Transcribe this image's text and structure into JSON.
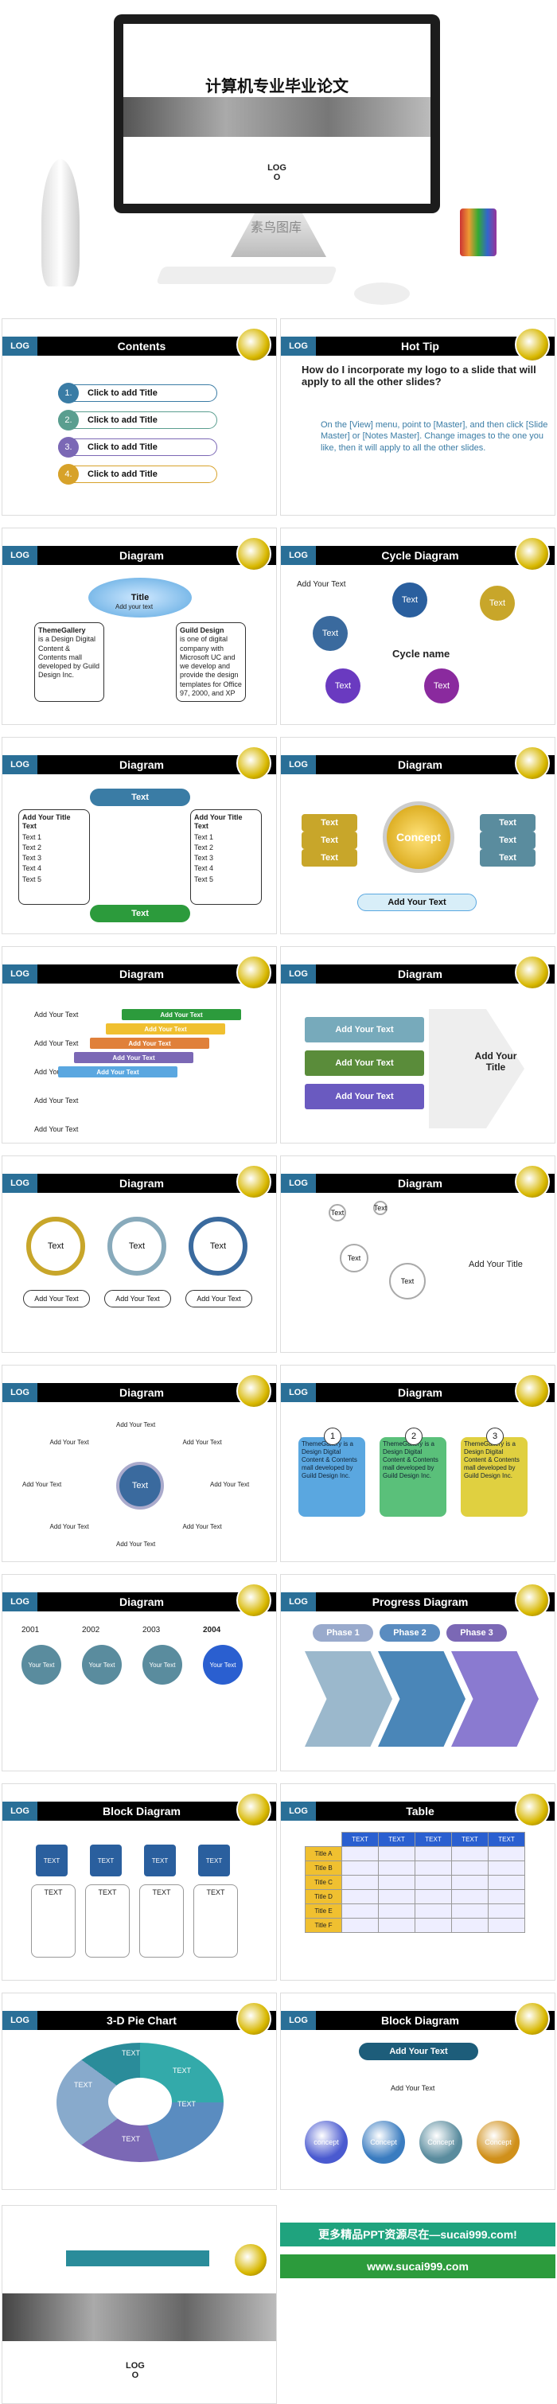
{
  "hero": {
    "title": "计算机专业毕业论文",
    "logo": "LOG\nO",
    "watermark": "素鸟图库"
  },
  "slides": [
    {
      "logo": "LOG",
      "title": "Contents",
      "items": [
        "Click to add Title",
        "Click to add Title",
        "Click to add Title",
        "Click to add Title"
      ],
      "numbers": [
        "1.",
        "2.",
        "3.",
        "4."
      ]
    },
    {
      "logo": "LOG",
      "title": "Hot Tip",
      "heading": "How do I incorporate my logo to a slide that will apply to all the other slides?",
      "body": "On the [View] menu, point to [Master], and then click [Slide Master] or [Notes Master]. Change images to the one you like, then it will apply to all the other slides."
    },
    {
      "logo": "LOG",
      "title": "Diagram",
      "top_title": "Title",
      "top_sub": "Add your text",
      "left_head": "ThemeGallery",
      "left_body": "is a Design Digital Content & Contents mall developed by Guild Design Inc.",
      "right_head": "Guild Design",
      "right_body": "is one of digital company with Microsoft UC and we develop and provide the design templates for Office 97, 2000, and XP"
    },
    {
      "logo": "LOG",
      "title": "Cycle Diagram",
      "add": "Add Your Text",
      "center": "Cycle name",
      "nodes": [
        "Text",
        "Text",
        "Text",
        "Text",
        "Text"
      ]
    },
    {
      "logo": "LOG",
      "title": "Diagram",
      "side_title": "Add Your Title Text",
      "list": [
        "Text 1",
        "Text 2",
        "Text 3",
        "Text 4",
        "Text 5"
      ],
      "bar": "Text"
    },
    {
      "logo": "LOG",
      "title": "Diagram",
      "concept": "Concept",
      "add": "Add Your Text",
      "stack": [
        "Text",
        "Text",
        "Text"
      ]
    },
    {
      "logo": "LOG",
      "title": "Diagram",
      "rows": [
        "Add Your Text",
        "Add Your Text",
        "Add Your Text",
        "Add Your Text",
        "Add Your Text"
      ]
    },
    {
      "logo": "LOG",
      "title": "Diagram",
      "bars": [
        "Add Your Text",
        "Add Your Text",
        "Add Your Text"
      ],
      "arrow": "Add Your Title"
    },
    {
      "logo": "LOG",
      "title": "Diagram",
      "rings": [
        "Text",
        "Text",
        "Text"
      ],
      "labels": [
        "Add Your Text",
        "Add Your Text",
        "Add Your Text"
      ]
    },
    {
      "logo": "LOG",
      "title": "Diagram",
      "bubbles": [
        "Text",
        "Text",
        "Text",
        "Text"
      ],
      "add": "Add Your Title"
    },
    {
      "logo": "LOG",
      "title": "Diagram",
      "center": "Text",
      "spokes": [
        "Add Your Text",
        "Add Your Text",
        "Add Your Text",
        "Add Your Text",
        "Add Your Text",
        "Add Your Text",
        "Add Your Text",
        "Add Your Text"
      ]
    },
    {
      "logo": "LOG",
      "title": "Diagram",
      "cards": [
        "ThemeGallery is a Design Digital Content & Contents mall developed by Guild Design Inc.",
        "ThemeGallery is a Design Digital Content & Contents mall developed by Guild Design Inc.",
        "ThemeGallery is a Design Digital Content & Contents mall developed by Guild Design Inc."
      ],
      "nums": [
        "1",
        "2",
        "3"
      ]
    },
    {
      "logo": "LOG",
      "title": "Diagram",
      "years": [
        "2001",
        "2002",
        "2003",
        "2004"
      ],
      "keys": [
        "Your Text",
        "Your Text",
        "Your Text",
        "Your Text"
      ]
    },
    {
      "logo": "LOG",
      "title": "Progress Diagram",
      "phases": [
        "Phase 1",
        "Phase 2",
        "Phase 3"
      ]
    },
    {
      "logo": "LOG",
      "title": "Block Diagram",
      "blocks": [
        "TEXT",
        "TEXT",
        "TEXT",
        "TEXT"
      ],
      "cells": [
        "TEXT",
        "TEXT",
        "TEXT",
        "TEXT"
      ]
    },
    {
      "logo": "LOG",
      "title": "Table",
      "head": [
        "TEXT",
        "TEXT",
        "TEXT",
        "TEXT",
        "TEXT"
      ],
      "rows": [
        "Title A",
        "Title B",
        "Title C",
        "Title D",
        "Title E",
        "Title F"
      ]
    },
    {
      "logo": "LOG",
      "title": "3-D Pie Chart",
      "parts": [
        "TEXT",
        "TEXT",
        "TEXT",
        "TEXT",
        "TEXT"
      ]
    },
    {
      "logo": "LOG",
      "title": "Block Diagram",
      "top": "Add Your Text",
      "mid": "Add Your Text",
      "concepts": [
        "concept",
        "Concept",
        "Concept",
        "Concept"
      ]
    }
  ],
  "footer": {
    "logo": "LOG\nO",
    "promo1": "更多精品PPT资源尽在—sucai999.com!",
    "promo2": "www.sucai999.com"
  },
  "colors": {
    "bar": "#000000",
    "logo": "#2a6f97",
    "teal": "#1fa37e",
    "green": "#2c9b3c"
  }
}
